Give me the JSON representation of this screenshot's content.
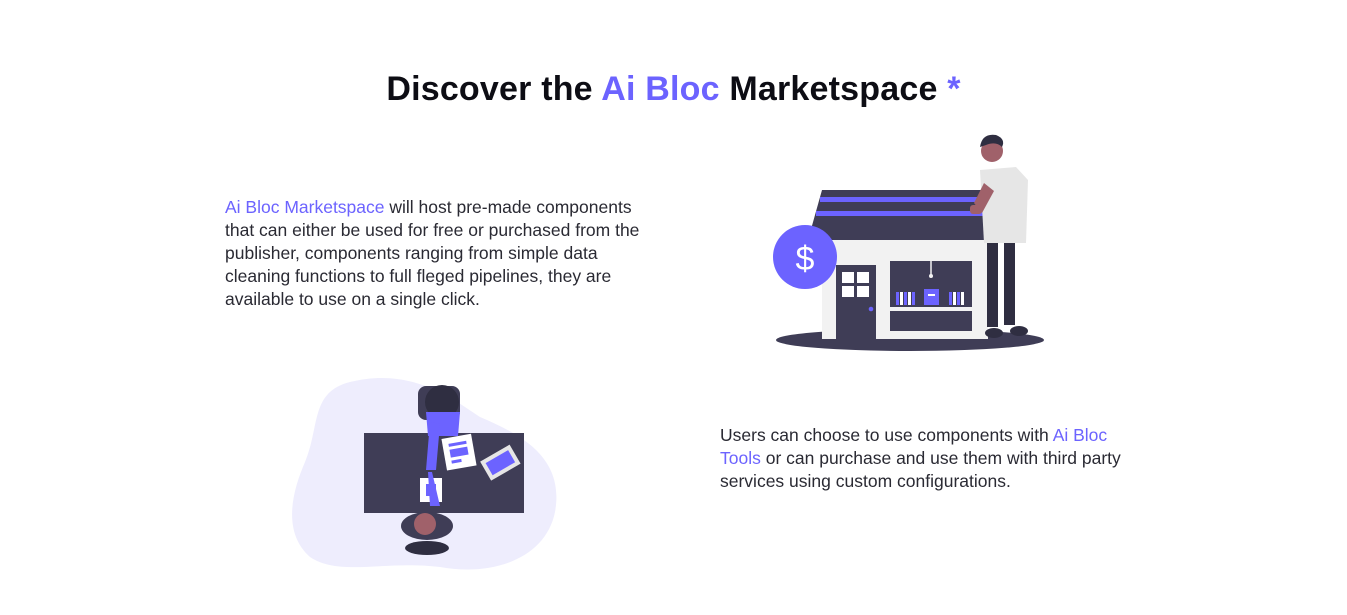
{
  "heading": {
    "prefix": "Discover the ",
    "highlight": "Ai Bloc",
    "suffix": " Marketspace ",
    "asterisk": "*"
  },
  "section_marketplace": {
    "highlight": "Ai Bloc Marketspace",
    "text": " will host pre-made components that can either be used for free or purchased from the publisher, components ranging from simple data cleaning functions to full fleged pipelines, they are available to use on a single click.",
    "illustration": "store-with-dollar-illustration"
  },
  "section_users": {
    "text_before": "Users can choose to use components with ",
    "highlight": "Ai Bloc Tools",
    "text_after": " or can purchase and use them with third party services using custom configurations.",
    "illustration": "handshake-meeting-illustration"
  },
  "colors": {
    "accent": "#6c63ff",
    "dark": "#3f3d56",
    "blob": "#eeedfd",
    "text": "#2a2a33"
  }
}
